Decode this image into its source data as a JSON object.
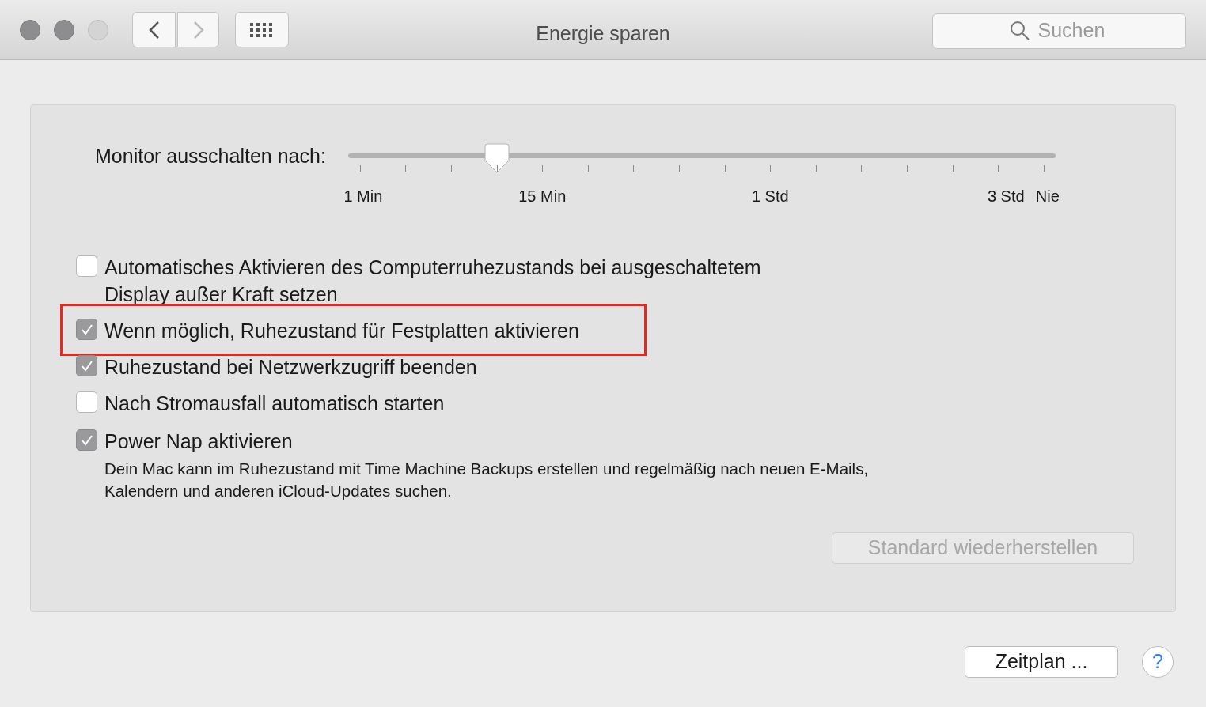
{
  "window": {
    "title": "Energie sparen",
    "search": {
      "placeholder": "Suchen"
    }
  },
  "slider": {
    "label": "Monitor ausschalten nach:",
    "level": 0.2,
    "tick_labels": [
      "1 Min",
      "15 Min",
      "1 Std",
      "3 Std",
      "Nie"
    ]
  },
  "options": [
    {
      "label": "Automatisches Aktivieren des Computerruhezustands bei ausgeschaltetem Display außer Kraft setzen",
      "checked": false,
      "highlighted": false
    },
    {
      "label": "Wenn möglich, Ruhezustand für Festplatten aktivieren",
      "checked": true,
      "highlighted": true
    },
    {
      "label": "Ruhezustand bei Netzwerkzugriff beenden",
      "checked": true,
      "highlighted": false
    },
    {
      "label": "Nach Stromausfall automatisch starten",
      "checked": false,
      "highlighted": false
    },
    {
      "label": "Power Nap aktivieren",
      "checked": true,
      "highlighted": false,
      "description": "Dein Mac kann im Ruhezustand mit Time Machine Backups erstellen und regelmäßig nach neuen E-Mails, Kalendern und anderen iCloud-Updates suchen."
    }
  ],
  "restore_button": {
    "label": "Standard wiederherstellen",
    "disabled": true
  },
  "schedule_button": {
    "label": "Zeitplan ..."
  },
  "help_button": {
    "label": "?"
  }
}
